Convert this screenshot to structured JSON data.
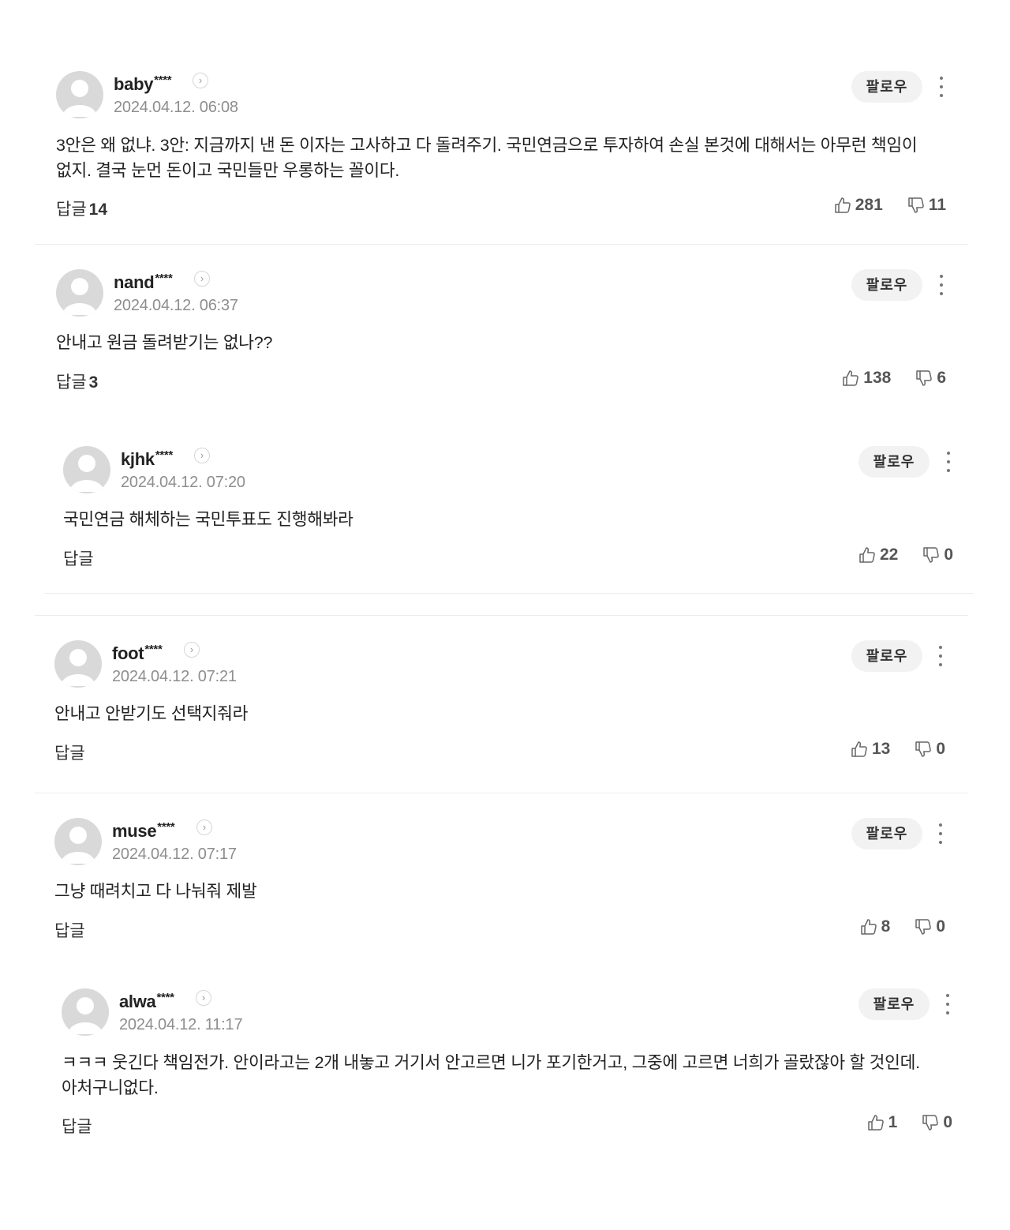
{
  "follow_label": "팔로우",
  "reply_label": "답글",
  "comments": [
    {
      "user": "baby",
      "mask": "****",
      "time": "2024.04.12. 06:08",
      "text": "3안은 왜 없냐. 3안: 지금까지 낸 돈 이자는 고사하고 다 돌려주기. 국민연금으로 투자하여 손실 본것에 대해서는 아무런 책임이 없지. 결국 눈먼 돈이고 국민들만 우롱하는 꼴이다.",
      "replies": "14",
      "likes": "281",
      "dislikes": "11"
    },
    {
      "user": "nand",
      "mask": "****",
      "time": "2024.04.12. 06:37",
      "text": "안내고 원금 돌려받기는 없나??",
      "replies": "3",
      "likes": "138",
      "dislikes": "6"
    },
    {
      "user": "kjhk",
      "mask": "****",
      "time": "2024.04.12. 07:20",
      "text": "국민연금 해체하는 국민투표도 진행해봐라",
      "replies": "",
      "likes": "22",
      "dislikes": "0"
    },
    {
      "user": "foot",
      "mask": "****",
      "time": "2024.04.12. 07:21",
      "text": "안내고 안받기도 선택지줘라",
      "replies": "",
      "likes": "13",
      "dislikes": "0"
    },
    {
      "user": "muse",
      "mask": "****",
      "time": "2024.04.12. 07:17",
      "text": "그냥 때려치고 다 나눠줘 제발",
      "replies": "",
      "likes": "8",
      "dislikes": "0"
    },
    {
      "user": "alwa",
      "mask": "****",
      "time": "2024.04.12. 11:17",
      "text": "ㅋㅋㅋ 웃긴다 책임전가. 안이라고는 2개 내놓고 거기서 안고르면 니가 포기한거고, 그중에 고르면 너희가 골랐잖아 할 것인데. 아처구니없다.",
      "replies": "",
      "likes": "1",
      "dislikes": "0"
    }
  ]
}
